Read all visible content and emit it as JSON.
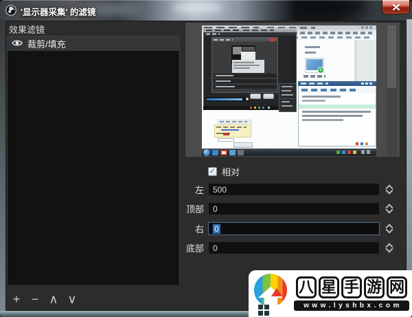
{
  "window": {
    "title": "'显示器采集' 的滤镜"
  },
  "left_pane": {
    "title": "效果滤镜",
    "filters": [
      {
        "label": "裁剪/填充",
        "visible": true,
        "selected": true
      }
    ],
    "toolbar": {
      "add": "+",
      "remove": "−",
      "move_up": "∧",
      "move_down": "∨"
    }
  },
  "properties": {
    "relative_checkbox": {
      "label": "相对",
      "checked": true,
      "checkmark": "✓"
    },
    "fields": [
      {
        "label": "左",
        "value": "500",
        "focused": false
      },
      {
        "label": "顶部",
        "value": "0",
        "focused": false
      },
      {
        "label": "右",
        "value": "0",
        "focused": true
      },
      {
        "label": "底部",
        "value": "0",
        "focused": false
      }
    ]
  },
  "colors": {
    "selection_highlight": "#2c6db8",
    "close_button_red": "#b03826",
    "client_background": "#2c2c2c",
    "preview_backdrop": "#4b4b4b",
    "watermark_logo_stripes": [
      "#2aa0dc",
      "#7cc242",
      "#fdd102",
      "#e83a2e"
    ]
  },
  "watermark": {
    "site_name": "八星手游网",
    "site_name_chars": [
      "八",
      "星",
      "手",
      "游",
      "网"
    ],
    "url": "www.lyshbx.com"
  }
}
